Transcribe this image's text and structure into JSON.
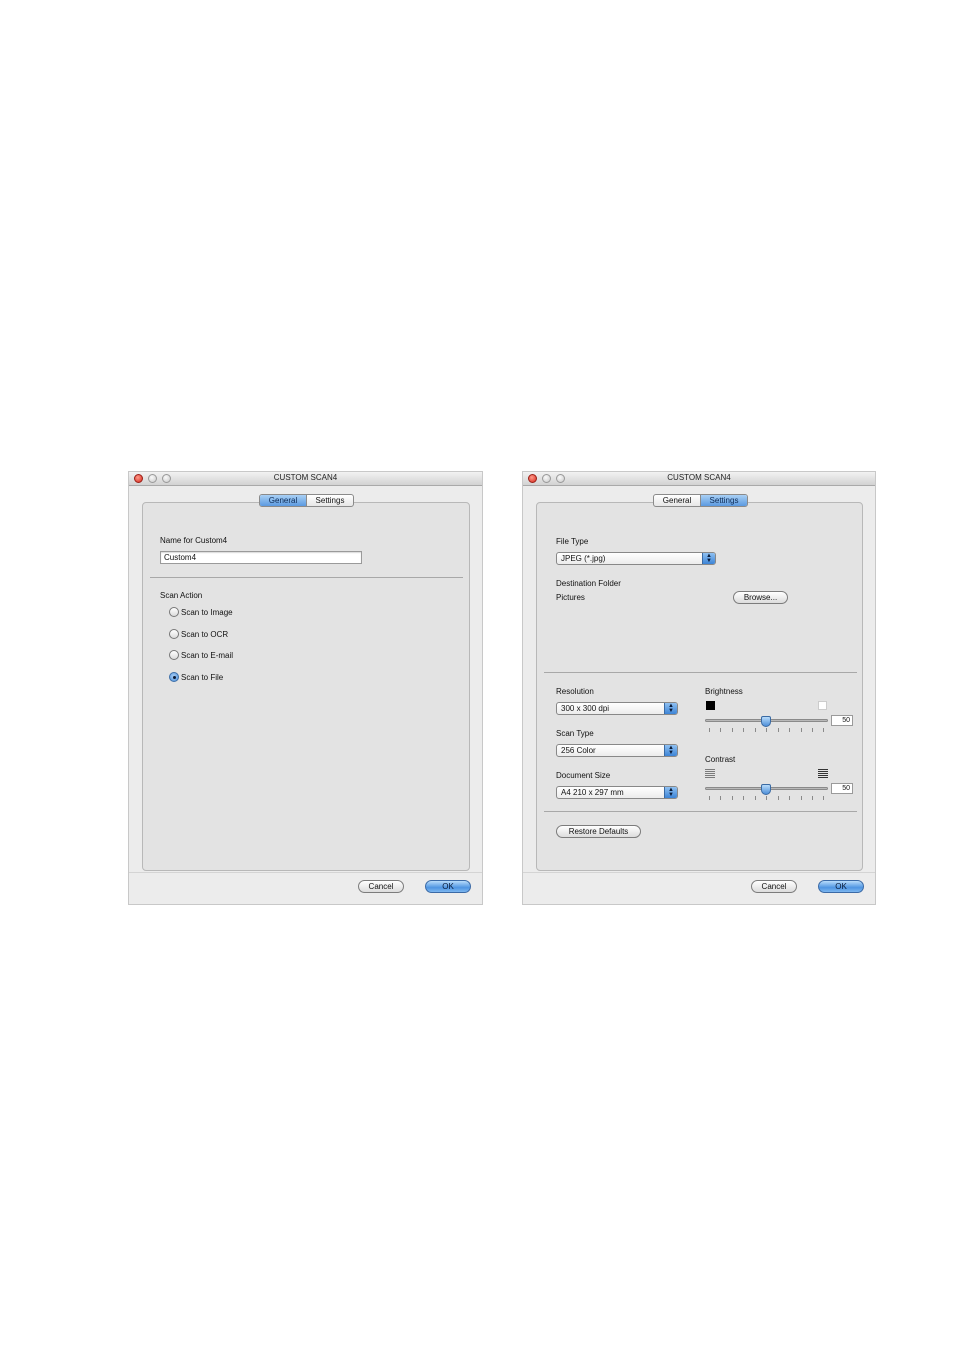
{
  "left_window": {
    "title": "CUSTOM SCAN4",
    "tabs": [
      {
        "label": "General",
        "selected": true
      },
      {
        "label": "Settings",
        "selected": false
      }
    ],
    "name_label": "Name for Custom4",
    "name_value": "Custom4",
    "scan_action_label": "Scan Action",
    "scan_actions": [
      {
        "label": "Scan to Image",
        "selected": false
      },
      {
        "label": "Scan to OCR",
        "selected": false
      },
      {
        "label": "Scan to E-mail",
        "selected": false
      },
      {
        "label": "Scan to File",
        "selected": true
      }
    ],
    "cancel_label": "Cancel",
    "ok_label": "OK"
  },
  "right_window": {
    "title": "CUSTOM SCAN4",
    "tabs": [
      {
        "label": "General",
        "selected": false
      },
      {
        "label": "Settings",
        "selected": true
      }
    ],
    "file_type_label": "File Type",
    "file_type_value": "JPEG (*.jpg)",
    "destination_label": "Destination Folder",
    "destination_value": "Pictures",
    "browse_label": "Browse...",
    "resolution_label": "Resolution",
    "resolution_value": "300 x 300 dpi",
    "scan_type_label": "Scan Type",
    "scan_type_value": "256 Color",
    "document_size_label": "Document Size",
    "document_size_value": "A4 210 x 297 mm",
    "brightness_label": "Brightness",
    "brightness_value": "50",
    "contrast_label": "Contrast",
    "contrast_value": "50",
    "restore_label": "Restore Defaults",
    "cancel_label": "Cancel",
    "ok_label": "OK"
  },
  "colors": {
    "accent": "#5b9ae0",
    "close_button": "#d8281c",
    "window_background": "#ececec"
  }
}
